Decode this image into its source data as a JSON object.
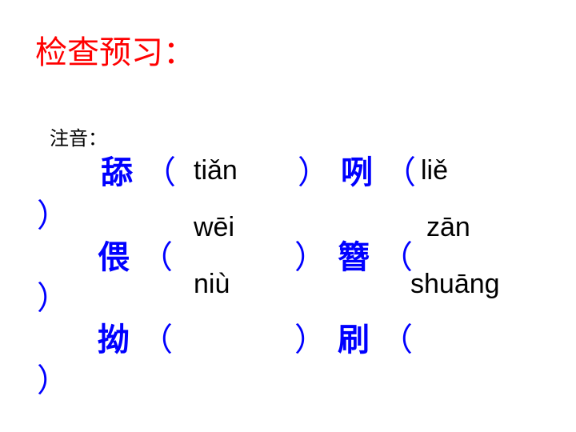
{
  "title": "检查预习：",
  "label": "注音：",
  "colors": {
    "title": "#ff0000",
    "characters": "#0000ff",
    "pinyin": "#000000"
  },
  "characters": [
    "舔",
    "咧",
    "偎",
    "簪",
    "拗",
    "刷"
  ],
  "open_paren": "（",
  "close_paren": "）",
  "pinyin": [
    "tiǎn",
    "liě",
    "wēi",
    "zān",
    "niù",
    "shuāng"
  ]
}
